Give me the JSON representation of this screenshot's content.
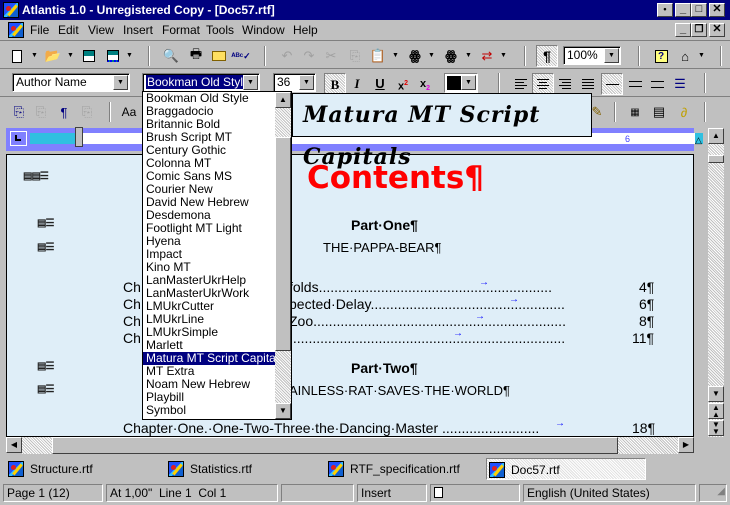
{
  "window": {
    "title": "Atlantis 1.0 - Unregistered Copy - [Doc57.rtf]",
    "controls": {
      "minimize": "_",
      "maximize": "□",
      "close": "✕",
      "extra": "•",
      "restore": "❐"
    }
  },
  "menu": [
    "File",
    "Edit",
    "View",
    "Insert",
    "Format",
    "Tools",
    "Window",
    "Help"
  ],
  "menu_accel": [
    "F",
    "E",
    "V",
    "I",
    "o",
    "T",
    "W",
    "H"
  ],
  "toolbar": {
    "zoom_value": "100%",
    "pilcrow": "¶",
    "icons": [
      "new-document-icon",
      "open-folder-icon",
      "save-icon",
      "save-as-icon",
      "print-preview-icon",
      "print-icon",
      "email-icon",
      "spell-check-icon",
      "undo-icon",
      "redo-icon",
      "cut-icon",
      "copy-icon",
      "paste-icon",
      "find-icon",
      "find-next-icon",
      "replace-icon",
      "show-formatting-icon",
      "help-icon",
      "home-icon"
    ]
  },
  "format_bar": {
    "style_value": "Author Name",
    "font_value": "Bookman Old Style",
    "size_value": "36",
    "bold": "B",
    "italic": "I",
    "underline": "U",
    "superscript": "x²",
    "subscript": "x₂",
    "text_color": "#000000"
  },
  "font_dropdown": {
    "items": [
      "Bookman Old Style",
      "Braggadocio",
      "Britannic Bold",
      "Brush Script MT",
      "Century Gothic",
      "Colonna MT",
      "Comic Sans MS",
      "Courier New",
      "David New Hebrew",
      "Desdemona",
      "Footlight MT Light",
      "Hyena",
      "Impact",
      "Kino MT",
      "LanMasterUkrHelp",
      "LanMasterUkrWork",
      "LMUkrCutter",
      "LMUkrLine",
      "LMUkrSimple",
      "Marlett",
      "Matura MT Script Capitals",
      "MT Extra",
      "Noam New Hebrew",
      "Playbill",
      "Symbol"
    ],
    "selected": "Matura MT Script Capitals",
    "preview_text": "Matura MT Script Capitals"
  },
  "ruler": {
    "label_6": "6"
  },
  "document": {
    "heading": "Contents¶",
    "heading_color": "#ff0000",
    "part_one": "Part·One¶",
    "part_one_subtitle": "THE·PAPPA-BEAR¶",
    "toc_part_one": [
      {
        "prefix": "Ch",
        "visible_text": "folds",
        "page": "4¶"
      },
      {
        "prefix": "Ch",
        "visible_text": "pected·Delay",
        "page": "6¶"
      },
      {
        "prefix": "Ch",
        "visible_text": "Zoo",
        "page": "8¶"
      },
      {
        "prefix": "Ch",
        "visible_text": "",
        "page": "11¶"
      }
    ],
    "part_two": "Part·Two¶",
    "part_two_subtitle": "AINLESS·RAT·SAVES·THE·WORLD¶",
    "toc_part_two": [
      {
        "text": "Chapter·One.·One-Two-Three·the·Dancing·Master",
        "page": "18¶"
      }
    ]
  },
  "open_documents": [
    {
      "name": "Structure.rtf",
      "active": false
    },
    {
      "name": "Statistics.rtf",
      "active": false
    },
    {
      "name": "RTF_specification.rtf",
      "active": false
    },
    {
      "name": "Doc57.rtf",
      "active": true
    }
  ],
  "status_bar": {
    "page": "Page 1 (12)",
    "position": "At 1,00\"  Line 1  Col 1",
    "blank": "",
    "mode": "Insert",
    "language": "English (United States)"
  }
}
